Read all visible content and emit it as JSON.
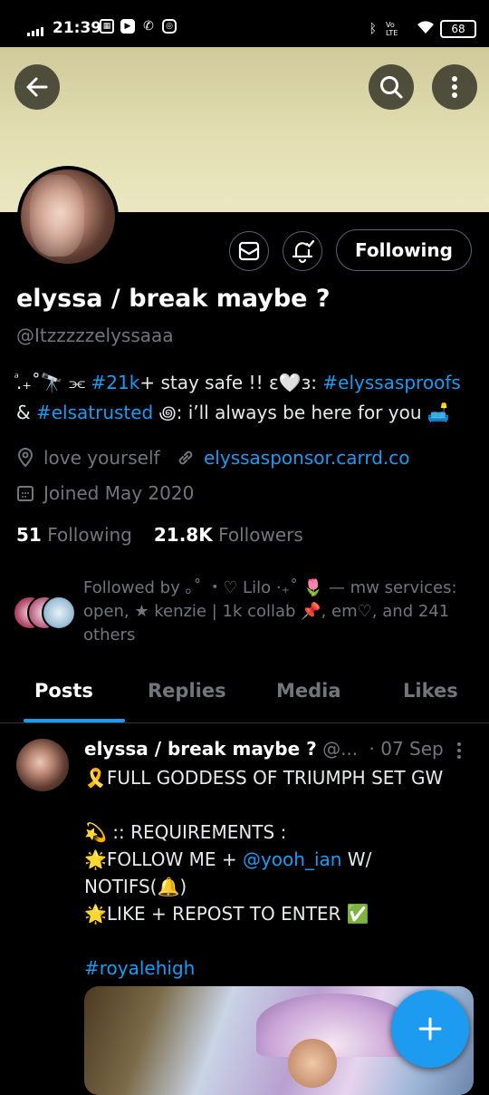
{
  "status_bar": {
    "time": "21:39",
    "battery": "68",
    "volte": "Vo LTE"
  },
  "profile": {
    "display_name": "elyssa / break maybe ?",
    "handle": "@Itzzzzzelyssaaa",
    "follow_button": "Following",
    "bio": {
      "line1_prefix": "ⷶ.₊˚🔭 ⫘",
      "hashtag_21k": "#21k",
      "line1_mid": "+ stay safe !! ε🤍ɜ: ",
      "hashtag_proofs": "#elyssasproofs",
      "line2_prefix": "& ",
      "hashtag_trusted": "#elsatrusted",
      "line2_suffix": " ꩜: i’ll always be here for you 🛋️"
    },
    "location": "love yourself",
    "website": "elyssasponsor.carrd.co",
    "joined": "Joined May 2020",
    "following_count": "51",
    "following_label": "Following",
    "followers_count": "21.8K",
    "followers_label": "Followers",
    "followed_by": "Followed by ｡˚ ・♡ Lilo ·₊˚ 🌷 — mw services: open, ★ kenzie | 1k collab 📌, em♡, and 241 others"
  },
  "tabs": [
    {
      "label": "Posts"
    },
    {
      "label": "Replies"
    },
    {
      "label": "Media"
    },
    {
      "label": "Likes"
    }
  ],
  "post": {
    "author": "elyssa / break maybe ?",
    "handle_trunc": "@...",
    "date": "· 07 Sep",
    "line1": "🎗️FULL GODDESS OF TRIUMPH SET GW",
    "line2": "💫 :: REQUIREMENTS :",
    "line3_prefix": "🌟FOLLOW ME + ",
    "mention": "@yooh_ian",
    "line3_suffix": " W/",
    "line4": "NOTIFS(🔔)",
    "line5": "🌟LIKE + REPOST TO ENTER ✅",
    "hashtag": "#royalehigh"
  },
  "colors": {
    "accent": "#1d9bf0",
    "secondary_text": "#71767b",
    "background": "#000000"
  },
  "icons": [
    "back-arrow-icon",
    "search-icon",
    "more-vertical-icon",
    "message-icon",
    "bell-add-icon",
    "location-icon",
    "link-icon",
    "calendar-icon",
    "compose-plus-icon"
  ]
}
